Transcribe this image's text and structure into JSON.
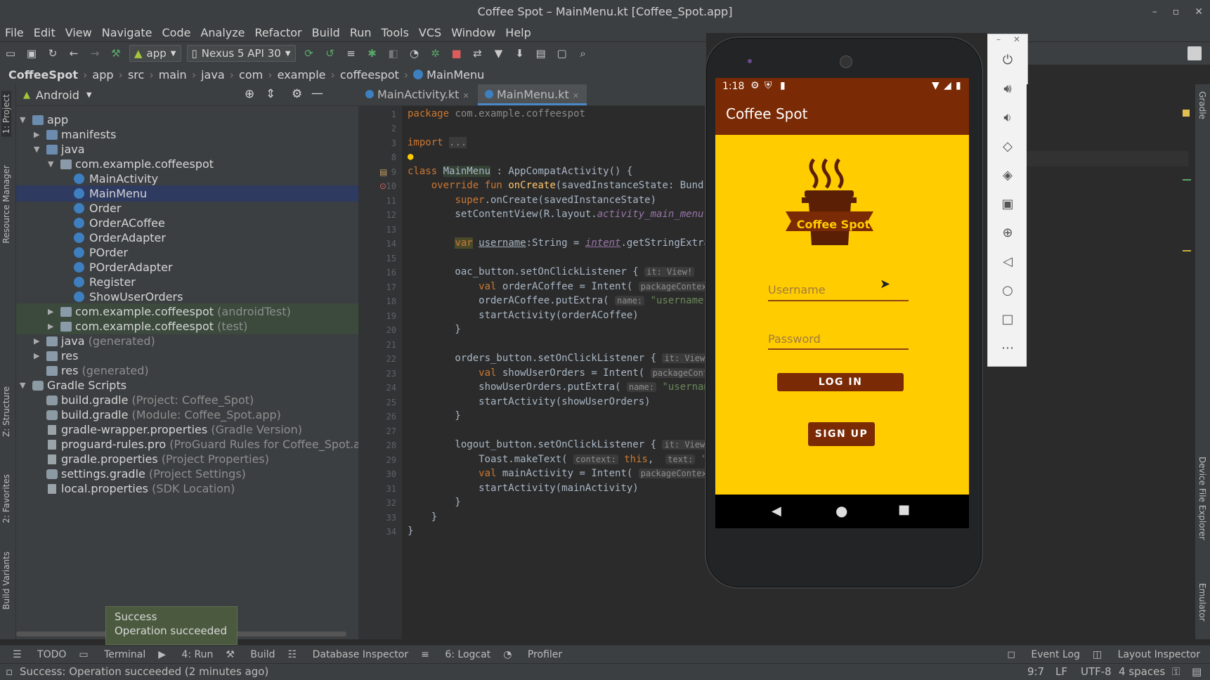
{
  "window": {
    "title": "Coffee Spot – MainMenu.kt [Coffee_Spot.app]"
  },
  "menu": [
    "File",
    "Edit",
    "View",
    "Navigate",
    "Code",
    "Analyze",
    "Refactor",
    "Build",
    "Run",
    "Tools",
    "VCS",
    "Window",
    "Help"
  ],
  "toolbar": {
    "run_config": "app",
    "device": "Nexus 5 API 30"
  },
  "breadcrumb": [
    "CoffeeSpot",
    "app",
    "src",
    "main",
    "java",
    "com",
    "example",
    "coffeespot",
    "MainMenu"
  ],
  "project": {
    "view_label": "Android",
    "tree": [
      {
        "label": "app",
        "hint": ""
      },
      {
        "label": "manifests",
        "hint": ""
      },
      {
        "label": "java",
        "hint": ""
      },
      {
        "label": "com.example.coffeespot",
        "hint": ""
      },
      {
        "label": "MainActivity",
        "hint": ""
      },
      {
        "label": "MainMenu",
        "hint": ""
      },
      {
        "label": "Order",
        "hint": ""
      },
      {
        "label": "OrderACoffee",
        "hint": ""
      },
      {
        "label": "OrderAdapter",
        "hint": ""
      },
      {
        "label": "POrder",
        "hint": ""
      },
      {
        "label": "POrderAdapter",
        "hint": ""
      },
      {
        "label": "Register",
        "hint": ""
      },
      {
        "label": "ShowUserOrders",
        "hint": ""
      },
      {
        "label": "com.example.coffeespot",
        "hint": "(androidTest)"
      },
      {
        "label": "com.example.coffeespot",
        "hint": "(test)"
      },
      {
        "label": "java",
        "hint": "(generated)"
      },
      {
        "label": "res",
        "hint": ""
      },
      {
        "label": "res",
        "hint": "(generated)"
      },
      {
        "label": "Gradle Scripts",
        "hint": ""
      },
      {
        "label": "build.gradle",
        "hint": "(Project: Coffee_Spot)"
      },
      {
        "label": "build.gradle",
        "hint": "(Module: Coffee_Spot.app)"
      },
      {
        "label": "gradle-wrapper.properties",
        "hint": "(Gradle Version)"
      },
      {
        "label": "proguard-rules.pro",
        "hint": "(ProGuard Rules for Coffee_Spot.ap"
      },
      {
        "label": "gradle.properties",
        "hint": "(Project Properties)"
      },
      {
        "label": "settings.gradle",
        "hint": "(Project Settings)"
      },
      {
        "label": "local.properties",
        "hint": "(SDK Location)"
      }
    ]
  },
  "editor": {
    "tabs": [
      "MainActivity.kt",
      "MainMenu.kt"
    ],
    "line_numbers": [
      "1",
      "2",
      "3",
      "8",
      "9",
      "10",
      "11",
      "12",
      "13",
      "14",
      "15",
      "16",
      "17",
      "18",
      "19",
      "20",
      "21",
      "22",
      "23",
      "24",
      "25",
      "26",
      "27",
      "28",
      "29",
      "30",
      "31",
      "32",
      "33",
      "34"
    ]
  },
  "side_tabs": {
    "left": [
      "1: Project",
      "Resource Manager",
      "Z: Structure",
      "2: Favorites",
      "Build Variants"
    ],
    "right": [
      "Gradle",
      "Device File Explorer",
      "Emulator"
    ]
  },
  "emulator": {
    "time": "1:18",
    "app_title": "Coffee Spot",
    "logo_text": "Coffee Spot",
    "username_placeholder": "Username",
    "password_placeholder": "Password",
    "login_label": "LOG IN",
    "signup_label": "SIGN UP"
  },
  "bottom": {
    "tabs": [
      "TODO",
      "Terminal",
      "4: Run",
      "Build",
      "Database Inspector",
      "6: Logcat",
      "Profiler"
    ],
    "right_tabs": [
      "Event Log",
      "Layout Inspector"
    ],
    "toast_title": "Success",
    "toast_message": "Operation succeeded",
    "status_message": "Success: Operation succeeded (2 minutes ago)",
    "cursor": "9:7",
    "line_sep": "LF",
    "encoding": "UTF-8",
    "indent": "4 spaces"
  },
  "colors": {
    "app_bar": "#7a2a05",
    "app_background": "#ffcc00",
    "ide_bg": "#2b2b2b",
    "selection": "#2f3a61"
  }
}
